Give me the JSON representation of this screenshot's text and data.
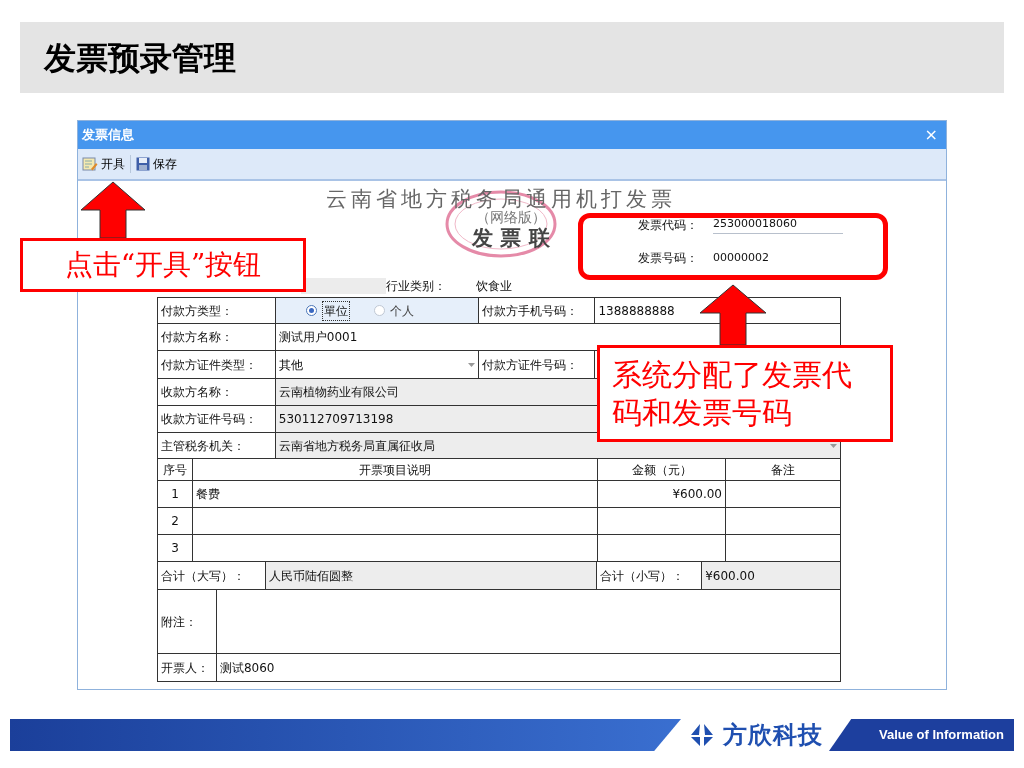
{
  "slide_title": "发票预录管理",
  "window": {
    "title": "发票信息",
    "close": "×"
  },
  "toolbar": [
    {
      "label": "开具",
      "kind": "issue"
    },
    {
      "label": "保存",
      "kind": "save"
    }
  ],
  "invoice_header": {
    "title": "云南省地方税务局通用机打发票",
    "subtitle": "（网络版）",
    "copy": "发 票 联",
    "code_label": "发票代码：",
    "code": "253000018060",
    "number_label": "发票号码：",
    "number": "00000002",
    "industry_label": "行业类别：",
    "industry": "饮食业"
  },
  "form": {
    "payer_type_label": "付款方类型：",
    "payer_type_options": [
      {
        "label": "單位",
        "selected": true
      },
      {
        "label": "个人",
        "selected": false
      }
    ],
    "payer_phone_label": "付款方手机号码：",
    "payer_phone": "1388888888",
    "payer_name_label": "付款方名称：",
    "payer_name": "测试用户0001",
    "payer_id_type_label": "付款方证件类型：",
    "payer_id_type": "其他",
    "payer_id_number_label": "付款方证件号码：",
    "payee_name_label": "收款方名称：",
    "payee_name": "云南植物药业有限公司",
    "payee_id_label": "收款方证件号码：",
    "payee_id": "530112709713198",
    "tax_office_label": "主管税务机关：",
    "tax_office": "云南省地方税务局直属征收局"
  },
  "items": {
    "columns": [
      "序号",
      "开票项目说明",
      "金额（元）",
      "备注"
    ],
    "rows": [
      {
        "no": "1",
        "description": "餐费",
        "amount": "¥600.00"
      },
      {
        "no": "2"
      },
      {
        "no": "3"
      }
    ]
  },
  "totals": {
    "upper_label": "合计（大写）：",
    "upper": "人民币陆佰圆整",
    "lower_label": "合计（小写）：",
    "lower": "¥600.00"
  },
  "remarks_label": "附注：",
  "issuer_label": "开票人：",
  "issuer": "测试8060",
  "callouts": [
    {
      "text": "点击“开具”按钮"
    },
    {
      "text": "系统分配了发票代码和发票号码"
    }
  ],
  "footer": {
    "brand": "方欣科技",
    "slogan": "Value of Information"
  }
}
